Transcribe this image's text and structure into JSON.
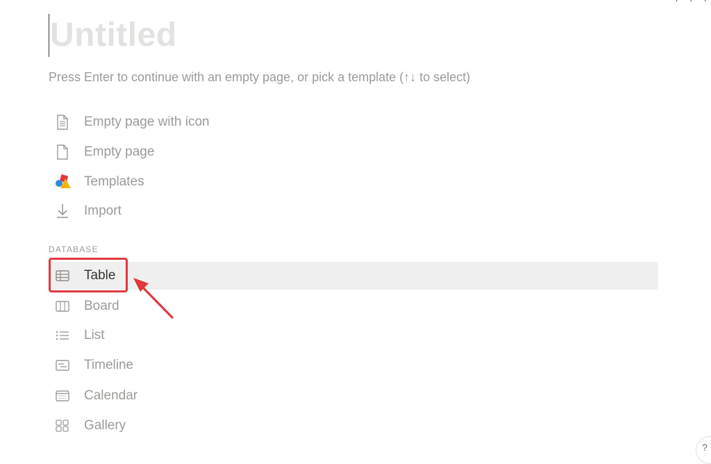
{
  "page": {
    "title_placeholder": "Untitled",
    "hint": "Press Enter to continue with an empty page, or pick a template (↑↓ to select)"
  },
  "options": [
    {
      "label": "Empty page with icon",
      "icon": "document-with-lines-icon"
    },
    {
      "label": "Empty page",
      "icon": "blank-document-icon"
    },
    {
      "label": "Templates",
      "icon": "templates-shapes-icon"
    },
    {
      "label": "Import",
      "icon": "import-arrow-icon"
    }
  ],
  "database": {
    "section_label": "DATABASE",
    "items": [
      {
        "label": "Table",
        "icon": "table-icon",
        "selected": true
      },
      {
        "label": "Board",
        "icon": "board-icon"
      },
      {
        "label": "List",
        "icon": "list-icon"
      },
      {
        "label": "Timeline",
        "icon": "timeline-icon"
      },
      {
        "label": "Calendar",
        "icon": "calendar-icon"
      },
      {
        "label": "Gallery",
        "icon": "gallery-icon"
      }
    ]
  },
  "annotation": {
    "color": "#e0383e",
    "target": "Table"
  },
  "colors": {
    "muted_text": "#9b9a97",
    "placeholder": "#e3e2e0",
    "selected_bg": "#efefef",
    "text": "#37352f"
  }
}
